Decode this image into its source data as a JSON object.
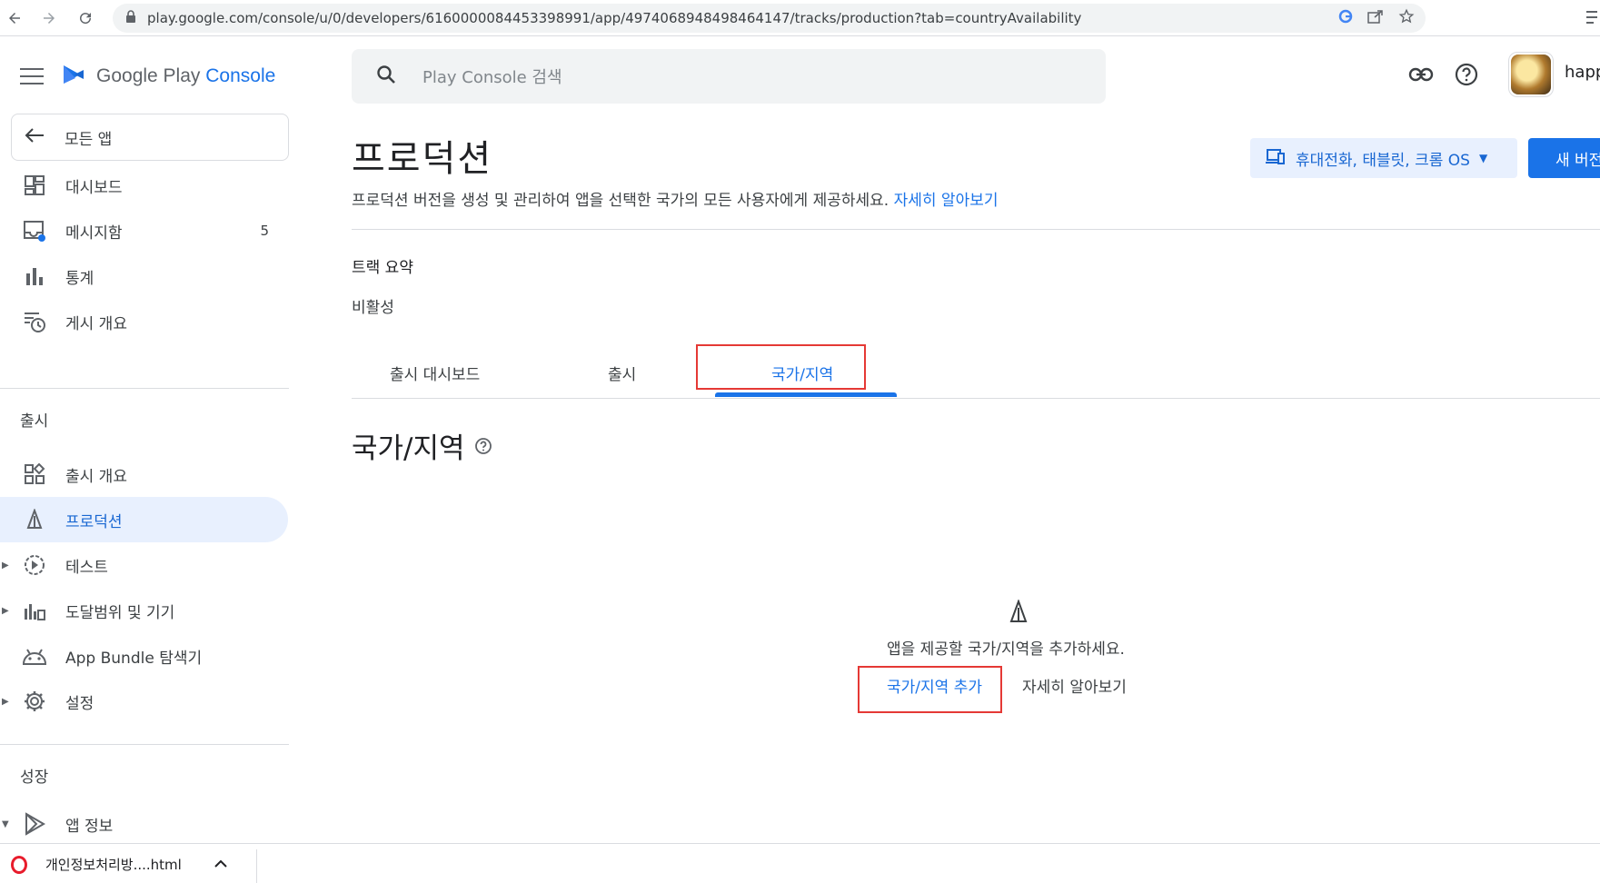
{
  "browser": {
    "url": "play.google.com/console/u/0/developers/6160000084453398991/app/4974068948498464147/tracks/production?tab=countryAvailability"
  },
  "brand": {
    "name_prefix": "Google Play",
    "name_suffix": "Console"
  },
  "search": {
    "placeholder": "Play Console 검색"
  },
  "user": {
    "name": "happ"
  },
  "sidebar": {
    "back_label": "모든 앱",
    "items": [
      {
        "label": "대시보드",
        "icon": "dashboard-icon"
      },
      {
        "label": "메시지함",
        "icon": "inbox-icon",
        "count": "5"
      },
      {
        "label": "통계",
        "icon": "bar-chart-icon"
      },
      {
        "label": "게시 개요",
        "icon": "publish-history-icon"
      }
    ],
    "section_release": "출시",
    "release_items": [
      {
        "label": "출시 개요",
        "icon": "release-overview-icon"
      },
      {
        "label": "프로덕션",
        "icon": "production-icon",
        "active": true
      },
      {
        "label": "테스트",
        "icon": "test-icon"
      },
      {
        "label": "도달범위 및 기기",
        "icon": "reach-devices-icon"
      },
      {
        "label": "App Bundle 탐색기",
        "icon": "android-icon"
      },
      {
        "label": "설정",
        "icon": "settings-icon"
      }
    ],
    "section_grow": "성장",
    "grow_items": [
      {
        "label": "앱 정보",
        "icon": "play-store-icon"
      }
    ]
  },
  "page": {
    "title": "프로덕션",
    "subtitle": "프로덕션 버전을 생성 및 관리하여 앱을 선택한 국가의 모든 사용자에게 제공하세요.",
    "subtitle_link": "자세히 알아보기",
    "device_button": "휴대전화, 태블릿, 크롬 OS",
    "new_button": "새 버전",
    "track_summary_label": "트랙 요약",
    "track_summary_value": "비활성",
    "tabs": [
      "출시 대시보드",
      "출시",
      "국가/지역"
    ],
    "section_title": "국가/지역",
    "empty_text": "앱을 제공할 국가/지역을 추가하세요.",
    "add_country": "국가/지역 추가",
    "learn_more": "자세히 알아보기"
  },
  "downloads": {
    "file_name": "개인정보처리방....html"
  },
  "colors": {
    "accent": "#1a73e8",
    "active_bg": "#e8f0fe",
    "highlight_box": "#e53935"
  }
}
